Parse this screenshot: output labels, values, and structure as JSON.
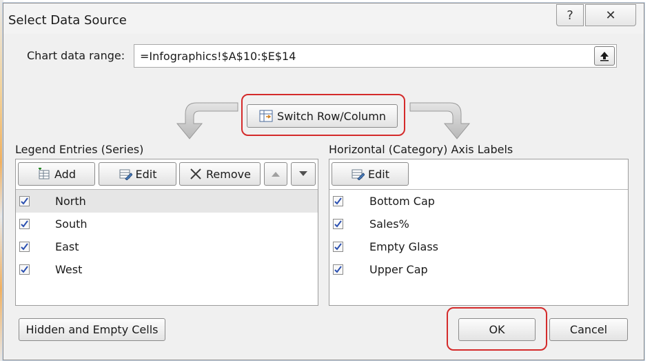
{
  "window": {
    "title": "Select Data Source",
    "help_icon": "help-icon",
    "close_icon": "close-icon"
  },
  "range": {
    "label": "Chart data range:",
    "value": "=Infographics!$A$10:$E$14"
  },
  "switch_button": "Switch Row/Column",
  "legend": {
    "title": "Legend Entries (Series)",
    "add": "Add",
    "edit": "Edit",
    "remove": "Remove",
    "items": [
      {
        "label": "North",
        "checked": true,
        "selected": true
      },
      {
        "label": "South",
        "checked": true
      },
      {
        "label": "East",
        "checked": true
      },
      {
        "label": "West",
        "checked": true
      }
    ]
  },
  "axis": {
    "title": "Horizontal (Category) Axis Labels",
    "edit": "Edit",
    "items": [
      {
        "label": "Bottom Cap",
        "checked": true
      },
      {
        "label": "Sales%",
        "checked": true
      },
      {
        "label": "Empty Glass",
        "checked": true
      },
      {
        "label": "Upper Cap",
        "checked": true
      }
    ]
  },
  "footer": {
    "hidden_cells": "Hidden and Empty Cells",
    "ok": "OK",
    "cancel": "Cancel"
  },
  "colors": {
    "highlight": "#d42a2a",
    "check": "#2a4fb0"
  }
}
